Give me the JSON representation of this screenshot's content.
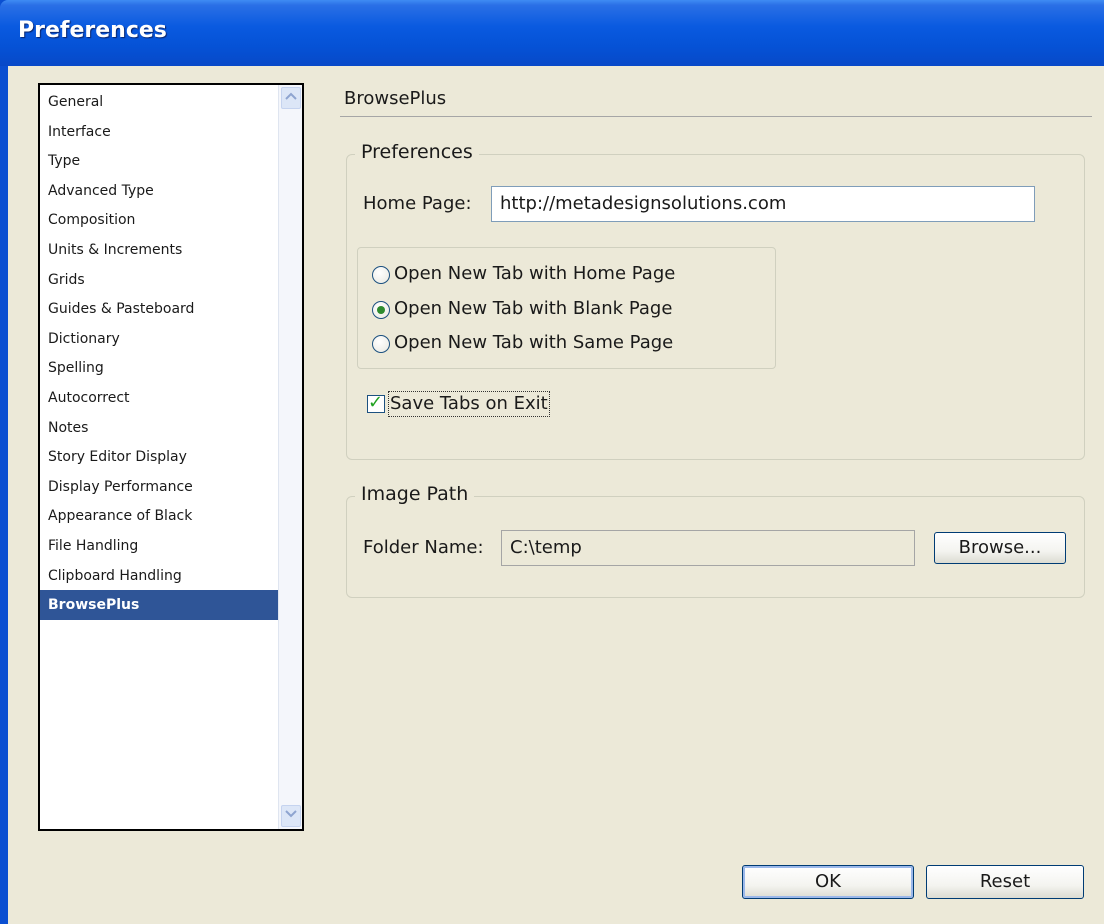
{
  "window": {
    "title": "Preferences"
  },
  "sidebar": {
    "items": [
      {
        "label": "General",
        "selected": false
      },
      {
        "label": "Interface",
        "selected": false
      },
      {
        "label": "Type",
        "selected": false
      },
      {
        "label": "Advanced Type",
        "selected": false
      },
      {
        "label": "Composition",
        "selected": false
      },
      {
        "label": "Units & Increments",
        "selected": false
      },
      {
        "label": "Grids",
        "selected": false
      },
      {
        "label": "Guides & Pasteboard",
        "selected": false
      },
      {
        "label": "Dictionary",
        "selected": false
      },
      {
        "label": "Spelling",
        "selected": false
      },
      {
        "label": "Autocorrect",
        "selected": false
      },
      {
        "label": "Notes",
        "selected": false
      },
      {
        "label": "Story Editor Display",
        "selected": false
      },
      {
        "label": "Display Performance",
        "selected": false
      },
      {
        "label": "Appearance of Black",
        "selected": false
      },
      {
        "label": "File Handling",
        "selected": false
      },
      {
        "label": "Clipboard Handling",
        "selected": false
      },
      {
        "label": "BrowsePlus",
        "selected": true
      }
    ]
  },
  "main": {
    "section_title": "BrowsePlus",
    "preferences_group": {
      "legend": "Preferences",
      "home_page_label": "Home Page:",
      "home_page_value": "http://metadesignsolutions.com",
      "new_tab_options": [
        {
          "label": "Open New Tab with Home Page",
          "checked": false
        },
        {
          "label": "Open New Tab with Blank Page",
          "checked": true
        },
        {
          "label": "Open New Tab with Same Page",
          "checked": false
        }
      ],
      "save_tabs_label": "Save Tabs on Exit",
      "save_tabs_checked": true
    },
    "image_path_group": {
      "legend": "Image Path",
      "folder_label": "Folder Name:",
      "folder_value": "C:\\temp",
      "browse_label": "Browse..."
    }
  },
  "footer": {
    "ok_label": "OK",
    "reset_label": "Reset"
  },
  "colors": {
    "title_bar": "#0552d6",
    "selection": "#2f5597",
    "dialog_bg": "#ece9d8",
    "radio_dot": "#2e8b2e",
    "check_mark": "#21a121"
  }
}
